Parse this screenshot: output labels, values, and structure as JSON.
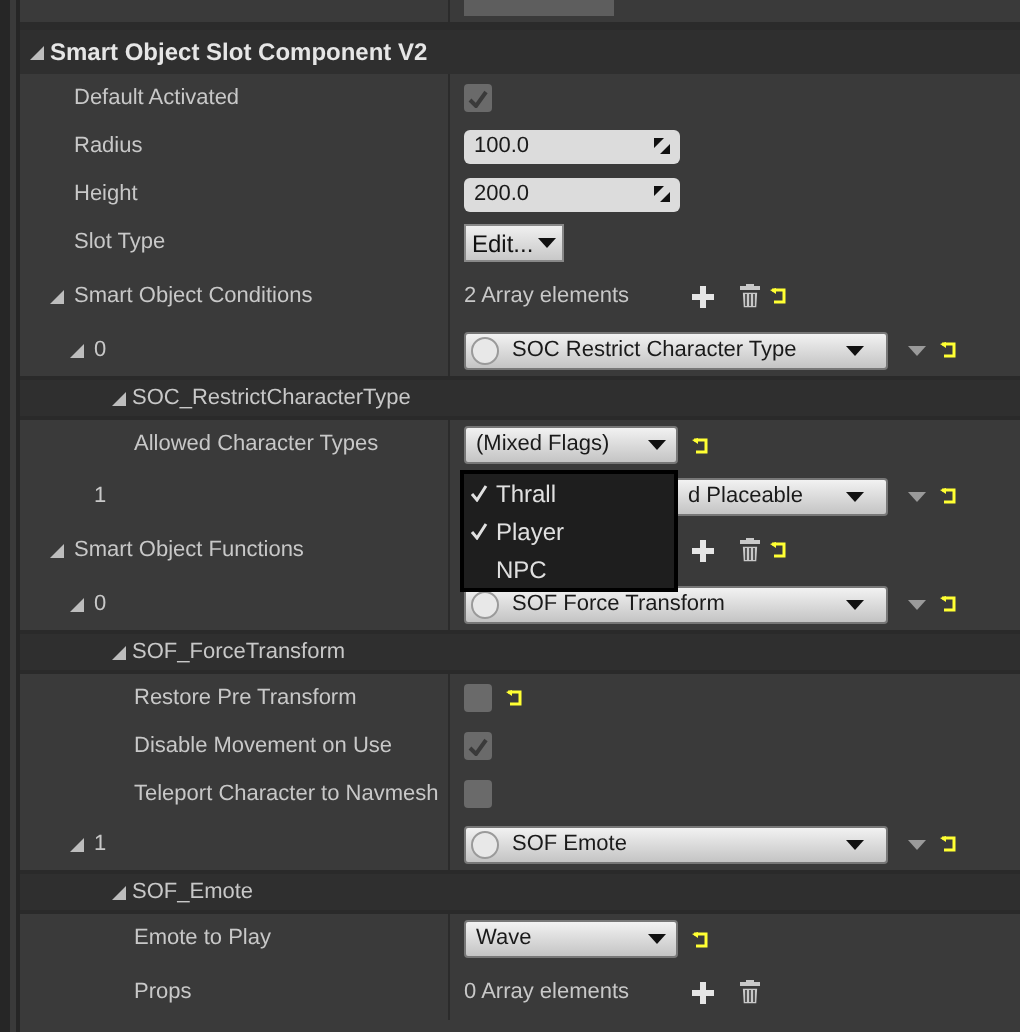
{
  "details_panel": {
    "sections": [
      {
        "title": "Smart Object Slot Component V2",
        "expanded": true,
        "properties": [
          {
            "label": "Default Activated",
            "kind": "checkbox",
            "checked": true
          },
          {
            "label": "Radius",
            "kind": "number",
            "value": "100.0"
          },
          {
            "label": "Height",
            "kind": "number",
            "value": "200.0"
          },
          {
            "label": "Slot Type",
            "kind": "combo",
            "value": "Edit..."
          },
          {
            "label": "Smart Object Conditions",
            "kind": "array",
            "count": "2 Array elements",
            "expanded": true,
            "reset": true,
            "children": [
              {
                "label": "0",
                "kind": "class",
                "value": "SOC Restrict Character Type",
                "expanded": true,
                "reset": true,
                "children": [
                  {
                    "label": "SOC_RestrictCharacterType",
                    "kind": "group",
                    "expanded": true,
                    "children": [
                      {
                        "label": "Allowed Character Types",
                        "kind": "enum",
                        "value": "(Mixed Flags)",
                        "reset": true
                      }
                    ]
                  }
                ]
              },
              {
                "label": "1",
                "kind": "class",
                "value": "d Placeable",
                "reset": true
              }
            ]
          },
          {
            "label": "Smart Object Functions",
            "kind": "array",
            "expanded": true,
            "reset": true,
            "children": [
              {
                "label": "0",
                "kind": "class",
                "value": "SOF Force Transform",
                "expanded": true,
                "reset": true,
                "children": [
                  {
                    "label": "SOF_ForceTransform",
                    "kind": "group",
                    "expanded": true,
                    "children": [
                      {
                        "label": "Restore Pre Transform",
                        "kind": "checkbox",
                        "checked": false,
                        "reset": true
                      },
                      {
                        "label": "Disable Movement on Use",
                        "kind": "checkbox",
                        "checked": true
                      },
                      {
                        "label": "Teleport Character to Navmesh",
                        "kind": "checkbox",
                        "checked": false
                      }
                    ]
                  }
                ]
              },
              {
                "label": "1",
                "kind": "class",
                "value": "SOF Emote",
                "expanded": true,
                "reset": true,
                "children": [
                  {
                    "label": "SOF_Emote",
                    "kind": "group",
                    "expanded": true,
                    "children": [
                      {
                        "label": "Emote to Play",
                        "kind": "enum",
                        "value": "Wave",
                        "reset": true
                      },
                      {
                        "label": "Props",
                        "kind": "array",
                        "count": "0 Array elements"
                      }
                    ]
                  }
                ]
              }
            ]
          }
        ]
      }
    ]
  },
  "flags_menu": {
    "items": [
      {
        "label": "Thrall",
        "checked": true
      },
      {
        "label": "Player",
        "checked": true
      },
      {
        "label": "NPC",
        "checked": false
      }
    ]
  }
}
